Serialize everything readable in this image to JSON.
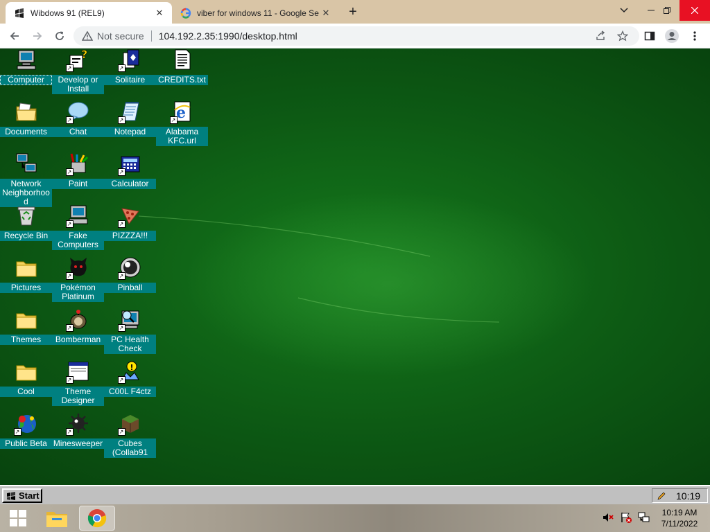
{
  "browser": {
    "tabs": [
      {
        "title": "Wibdows 91 (REL9)",
        "active": true
      },
      {
        "title": "viber for windows 11 - Google Se",
        "active": false
      }
    ],
    "security_label": "Not secure",
    "url": "104.192.2.35:1990/desktop.html"
  },
  "desktop": {
    "icons": [
      {
        "label": "Computer",
        "icon": "computer-icon"
      },
      {
        "label": "Develop or Install",
        "icon": "develop-install-icon"
      },
      {
        "label": "Solitaire",
        "icon": "solitaire-icon"
      },
      {
        "label": "CREDITS.txt",
        "icon": "text-file-icon"
      },
      {
        "label": "Documents",
        "icon": "documents-folder-icon"
      },
      {
        "label": "Chat",
        "icon": "chat-bubble-icon"
      },
      {
        "label": "Notepad",
        "icon": "notepad-icon"
      },
      {
        "label": "Alabama KFC.url",
        "icon": "internet-shortcut-icon"
      },
      {
        "label": "Network Neighborhood",
        "icon": "network-icon"
      },
      {
        "label": "Paint",
        "icon": "paint-icon"
      },
      {
        "label": "Calculator",
        "icon": "calculator-icon"
      },
      {
        "label": "Recycle Bin",
        "icon": "recycle-bin-icon"
      },
      {
        "label": "Fake Computers",
        "icon": "fake-computers-icon"
      },
      {
        "label": "PIZZZA!!!",
        "icon": "pizza-icon"
      },
      {
        "label": "Pictures",
        "icon": "folder-icon"
      },
      {
        "label": "Pokémon Platinum",
        "icon": "pokemon-icon"
      },
      {
        "label": "Pinball",
        "icon": "pinball-icon"
      },
      {
        "label": "Themes",
        "icon": "folder-icon"
      },
      {
        "label": "Bomberman",
        "icon": "bomberman-icon"
      },
      {
        "label": "PC Health Check",
        "icon": "pc-health-icon"
      },
      {
        "label": "Cool",
        "icon": "folder-icon"
      },
      {
        "label": "Theme Designer",
        "icon": "theme-designer-icon"
      },
      {
        "label": "C00L F4ctz",
        "icon": "cool-facts-icon"
      },
      {
        "label": "Public Beta",
        "icon": "public-beta-icon"
      },
      {
        "label": "Minesweeper",
        "icon": "minesweeper-icon"
      },
      {
        "label": "Cubes (Collab91",
        "icon": "cubes-icon"
      }
    ]
  },
  "w91_taskbar": {
    "start_label": "Start",
    "clock": "10:19"
  },
  "win_taskbar": {
    "time": "10:19 AM",
    "date": "7/11/2022"
  },
  "colors": {
    "label_bg": "#008080",
    "desktop_green": "#0d5a14",
    "tab_strip": "#d9c5a6"
  }
}
